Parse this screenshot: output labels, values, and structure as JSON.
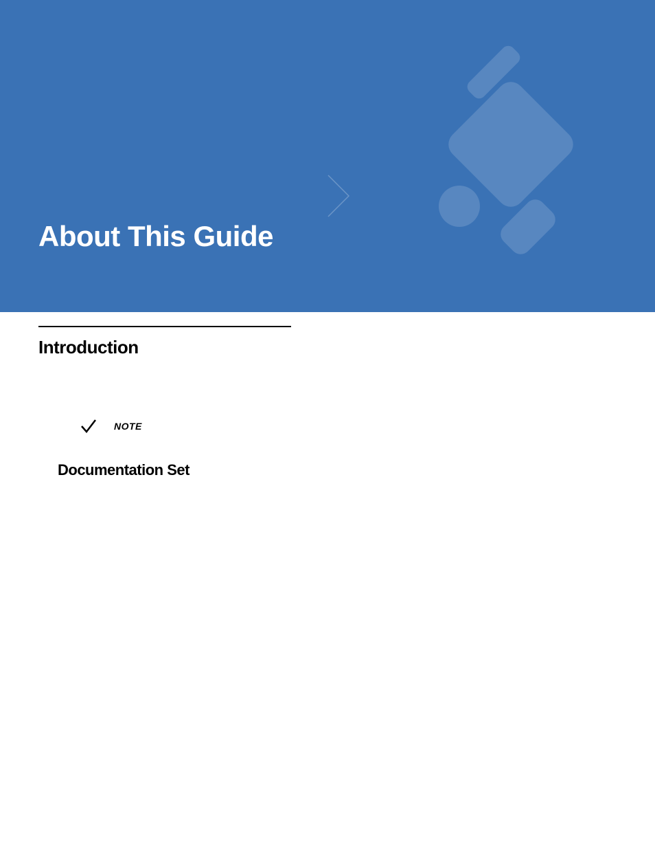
{
  "banner": {
    "title": "About This Guide"
  },
  "content": {
    "section_heading": "Introduction",
    "note_label": "NOTE",
    "subsection_heading": "Documentation Set"
  }
}
